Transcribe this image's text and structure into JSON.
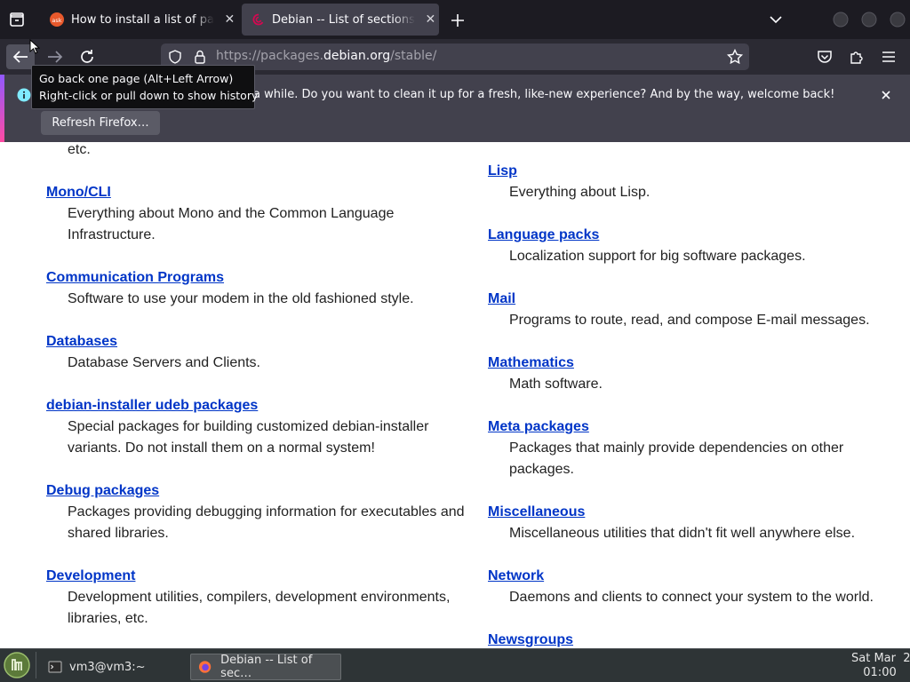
{
  "tabs": [
    {
      "title": "How to install a list of packages",
      "favicon": "ask-favicon"
    },
    {
      "title": "Debian -- List of sections in",
      "favicon": "debian-favicon",
      "active": true
    }
  ],
  "toolbar": {
    "url_prefix": "https://packages.",
    "url_host": "debian.org",
    "url_path": "/stable/"
  },
  "tooltip": {
    "line1": "Go back one page (Alt+Left Arrow)",
    "line2": "Right-click or pull down to show history"
  },
  "notification": {
    "message": "a while. Do you want to clean it up for a fresh, like-new experience? And by the way, welcome back!",
    "button": "Refresh Firefox…"
  },
  "left_sections": [
    {
      "title": "",
      "desc": "etc."
    },
    {
      "title": "Mono/CLI",
      "desc": "Everything about Mono and the Common Language Infrastructure."
    },
    {
      "title": "Communication Programs",
      "desc": "Software to use your modem in the old fashioned style."
    },
    {
      "title": "Databases",
      "desc": "Database Servers and Clients."
    },
    {
      "title": "debian-installer udeb packages",
      "desc": "Special packages for building customized debian-installer variants. Do not install them on a normal system!"
    },
    {
      "title": "Debug packages",
      "desc": "Packages providing debugging information for executables and shared libraries."
    },
    {
      "title": "Development",
      "desc": "Development utilities, compilers, development environments, libraries, etc."
    }
  ],
  "right_sections": [
    {
      "title": "Lisp",
      "desc": "Everything about Lisp."
    },
    {
      "title": "Language packs",
      "desc": "Localization support for big software packages."
    },
    {
      "title": "Mail",
      "desc": "Programs to route, read, and compose E-mail messages."
    },
    {
      "title": "Mathematics",
      "desc": "Math software."
    },
    {
      "title": "Meta packages",
      "desc": "Packages that mainly provide dependencies on other packages."
    },
    {
      "title": "Miscellaneous",
      "desc": "Miscellaneous utilities that didn't fit well anywhere else."
    },
    {
      "title": "Network",
      "desc": "Daemons and clients to connect your system to the world."
    },
    {
      "title": "Newsgroups",
      "desc": ""
    }
  ],
  "taskbar": {
    "terminal": "vm3@vm3:~",
    "browser": "Debian -- List of sec…",
    "clock_date": "Sat Mar  2",
    "clock_time": "01:00"
  },
  "colors": {
    "link": "#0035c7",
    "chrome_dark": "#1c1b22",
    "accent": "#9059ff"
  }
}
